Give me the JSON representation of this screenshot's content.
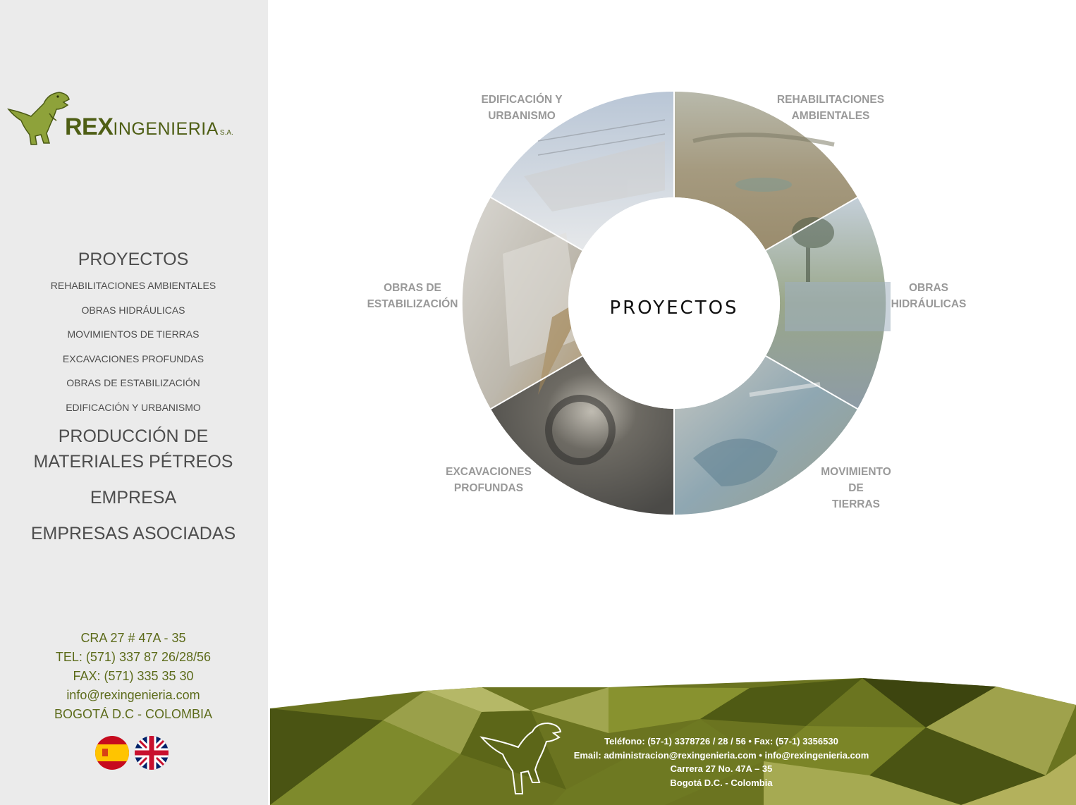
{
  "brand": {
    "name_bold": "REX",
    "name_rest": "INGENIERIA",
    "suffix": "S.A."
  },
  "nav": {
    "projects": "PROYECTOS",
    "sub_items": [
      "REHABILITACIONES AMBIENTALES",
      "OBRAS HIDRÁULICAS",
      "MOVIMIENTOS DE TIERRAS",
      "EXCAVACIONES PROFUNDAS",
      "OBRAS DE ESTABILIZACIÓN",
      "EDIFICACIÓN Y URBANISMO"
    ],
    "materials_line1": "PRODUCCIÓN DE",
    "materials_line2": "MATERIALES PÉTREOS",
    "company": "EMPRESA",
    "associates": "EMPRESAS ASOCIADAS"
  },
  "contact": {
    "address": "CRA 27 # 47A - 35",
    "tel": "TEL: (571) 337 87 26/28/56",
    "fax": "FAX: (571) 335 35 30",
    "email": "info@rexingenieria.com",
    "city": "BOGOTÁ D.C - COLOMBIA"
  },
  "languages": [
    "spanish-flag-icon",
    "uk-flag-icon"
  ],
  "wheel": {
    "center": "PROYECTOS",
    "segments": {
      "edificacion": [
        "EDIFICACIÓN Y",
        "URBANISMO"
      ],
      "rehabilitaciones": [
        "REHABILITACIONES",
        "AMBIENTALES"
      ],
      "hidraulicas": [
        "OBRAS",
        "HIDRÁULICAS"
      ],
      "movimiento": [
        "MOVIMIENTO",
        "DE",
        "TIERRAS"
      ],
      "excavaciones": [
        "EXCAVACIONES",
        "PROFUNDAS"
      ],
      "estabilizacion": [
        "OBRAS DE",
        "ESTABILIZACIÓN"
      ]
    }
  },
  "footer": {
    "phone": "Teléfono: (57-1) 3378726 / 28 / 56 • Fax: (57-1) 3356530",
    "email": "Email: administracion@rexingenieria.com • info@rexingenieria.com",
    "address": "Carrera 27 No. 47A – 35",
    "city": "Bogotá D.C. - Colombia"
  },
  "colors": {
    "accent": "#5c6b1a",
    "olive_dark": "#4a5413",
    "olive_light": "#9aa04a"
  }
}
